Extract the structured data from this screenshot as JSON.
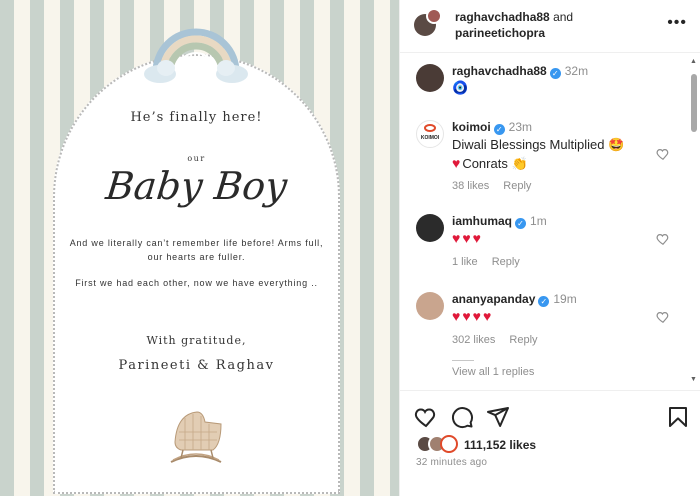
{
  "post": {
    "heading": "He’s finally here!",
    "our": "our",
    "title": "Baby Boy",
    "message1": "And we literally can’t remember life before! Arms full, our hearts are fuller.",
    "message2": "First we had each other, now we have everything ..",
    "gratitude": "With gratitude,",
    "signature": "Parineeti & Raghav"
  },
  "header": {
    "author": "raghavchadha88",
    "and": "and",
    "collaborator": "parineetichopra",
    "more_icon": "more-horizontal-icon"
  },
  "comments": [
    {
      "user": "raghavchadha88",
      "verified": true,
      "time": "32m",
      "text": "🧿",
      "likes": "",
      "reply": ""
    },
    {
      "user": "koimoi",
      "verified": true,
      "time": "23m",
      "text_line1": "Diwali Blessings Multiplied 🤩",
      "text_line2": "Conrats 👏",
      "likes": "38 likes",
      "reply": "Reply",
      "avatar_label": "KOIMOI"
    },
    {
      "user": "iamhumaq",
      "verified": true,
      "time": "1m",
      "hearts": 3,
      "likes": "1 like",
      "reply": "Reply"
    },
    {
      "user": "ananyapanday",
      "verified": true,
      "time": "19m",
      "hearts": 4,
      "likes": "302 likes",
      "reply": "Reply"
    }
  ],
  "view_replies": "View all 1 replies",
  "actions": {
    "like_icon": "heart-outline-icon",
    "comment_icon": "comment-icon",
    "share_icon": "paper-plane-icon",
    "save_icon": "bookmark-icon",
    "likes_count": "111,152 likes",
    "time_ago": "32 minutes ago"
  },
  "colors": {
    "verified": "#3897f0",
    "heart": "#e0193a",
    "stripe_green": "#c9d3cc",
    "stripe_cream": "#f8f5ec"
  }
}
